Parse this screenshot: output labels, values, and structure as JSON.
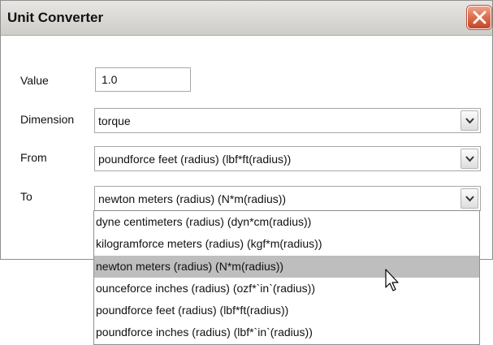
{
  "window": {
    "title": "Unit Converter"
  },
  "form": {
    "value_label": "Value",
    "value": "1.0",
    "dimension_label": "Dimension",
    "dimension_value": "torque",
    "from_label": "From",
    "from_value": "poundforce feet (radius) (lbf*ft(radius))",
    "to_label": "To",
    "to_value": "newton meters (radius) (N*m(radius))"
  },
  "dropdown": {
    "options": [
      {
        "label": "dyne centimeters (radius) (dyn*cm(radius))"
      },
      {
        "label": "kilogramforce meters (radius) (kgf*m(radius))"
      },
      {
        "label": "newton meters (radius) (N*m(radius))"
      },
      {
        "label": "ounceforce inches (radius) (ozf*`in`(radius))"
      },
      {
        "label": "poundforce feet (radius) (lbf*ft(radius))"
      },
      {
        "label": "poundforce inches (radius) (lbf*`in`(radius))"
      }
    ],
    "selected_index": 2
  },
  "icons": {
    "close": "close-icon",
    "dropdown_arrow": "chevron-down-icon",
    "cursor": "mouse-pointer-icon"
  },
  "colors": {
    "close_button": "#e07050",
    "selected_option": "#bebebe"
  }
}
